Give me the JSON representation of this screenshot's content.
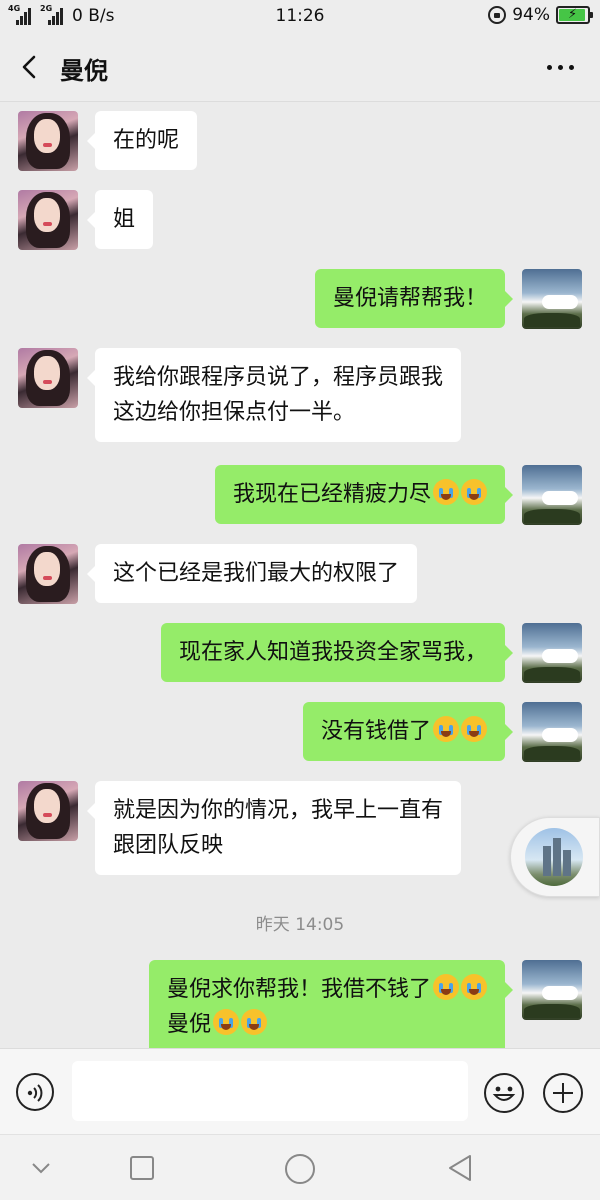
{
  "status_bar": {
    "sim1": "4G",
    "sim2": "2G",
    "net_speed": "0 B/s",
    "time": "11:26",
    "battery": "94%",
    "battery_level": 0.94,
    "battery_color": "#46c546"
  },
  "header": {
    "back_icon": "chevron-left-icon",
    "title": "曼倪",
    "more_icon": "more-dots-icon"
  },
  "messages": [
    {
      "side": "left",
      "text": "在的呢"
    },
    {
      "side": "left",
      "text": "姐"
    },
    {
      "side": "right",
      "text": "曼倪请帮帮我！"
    },
    {
      "side": "left",
      "lines": [
        "我给你跟程序员说了，程序员跟我",
        "这边给你担保点付一半。"
      ]
    },
    {
      "side": "right",
      "text": "我现在已经精疲力尽",
      "emoji": [
        "crying",
        "crying"
      ]
    },
    {
      "side": "left",
      "text": "这个已经是我们最大的权限了"
    },
    {
      "side": "right",
      "text": "现在家人知道我投资全家骂我，"
    },
    {
      "side": "right",
      "text": "没有钱借了",
      "emoji": [
        "crying",
        "crying"
      ]
    },
    {
      "side": "left",
      "lines": [
        "就是因为你的情况，我早上一直有",
        "跟团队反映"
      ]
    },
    {
      "side": "right",
      "lines": [
        "曼倪求你帮我！我借不钱了",
        "曼倪"
      ],
      "emoji_line1": [
        "crying",
        "crying"
      ],
      "emoji_line2": [
        "crying",
        "crying"
      ]
    }
  ],
  "timestamp": "昨天 14:05",
  "input": {
    "placeholder": "",
    "voice_icon": "voice-icon",
    "emoji_icon": "smiley-icon",
    "plus_icon": "plus-icon"
  },
  "colors": {
    "sent_bubble": "#95ec69",
    "received_bubble": "#ffffff",
    "background": "#ebebeb"
  }
}
